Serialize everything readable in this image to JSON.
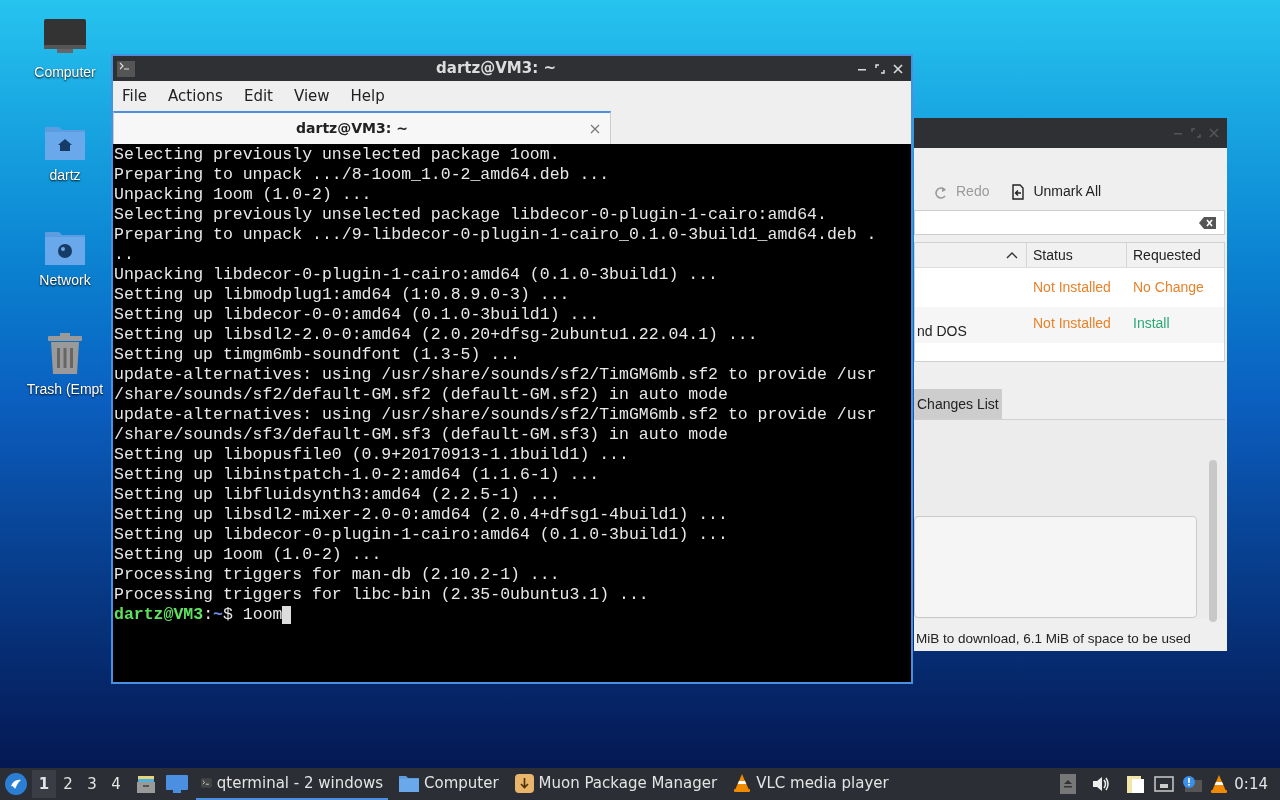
{
  "desktop_icons": [
    {
      "kind": "monitor",
      "label": "Computer"
    },
    {
      "kind": "home",
      "label": "dartz"
    },
    {
      "kind": "network",
      "label": "Network"
    },
    {
      "kind": "trash",
      "label": "Trash (Empt"
    }
  ],
  "muon": {
    "toolbar": [
      {
        "label": "Redo",
        "disabled": true,
        "kind": "redo"
      },
      {
        "label": "Unmark All",
        "disabled": false,
        "kind": "unmark"
      }
    ],
    "columns": [
      "Status",
      "Requested"
    ],
    "rows": [
      {
        "name": "",
        "status": {
          "text": "Not Installed",
          "color": "#e8822a"
        },
        "requested": {
          "text": "No Change",
          "color": "#e8822a"
        }
      },
      {
        "name": "nd DOS",
        "status": {
          "text": "Not Installed",
          "color": "#e8822a"
        },
        "requested": {
          "text": "Install",
          "color": "#2aa876"
        }
      }
    ],
    "tabs": [
      {
        "label": "Changes List",
        "selected": true
      }
    ],
    "status_bar": "MiB to download, 6.1 MiB of space to be used"
  },
  "terminal": {
    "title": "dartz@VM3: ~",
    "menu": [
      "File",
      "Actions",
      "Edit",
      "View",
      "Help"
    ],
    "tabs": [
      {
        "label": "dartz@VM3: ~",
        "selected": true
      }
    ],
    "lines": [
      {
        "kind": "output",
        "text": "Selecting previously unselected package 1oom."
      },
      {
        "kind": "output",
        "text": "Preparing to unpack .../8-1oom_1.0-2_amd64.deb ..."
      },
      {
        "kind": "output",
        "text": "Unpacking 1oom (1.0-2) ..."
      },
      {
        "kind": "output",
        "text": "Selecting previously unselected package libdecor-0-plugin-1-cairo:amd64."
      },
      {
        "kind": "output",
        "text": "Preparing to unpack .../9-libdecor-0-plugin-1-cairo_0.1.0-3build1_amd64.deb ."
      },
      {
        "kind": "output",
        "text": ".."
      },
      {
        "kind": "output",
        "text": "Unpacking libdecor-0-plugin-1-cairo:amd64 (0.1.0-3build1) ..."
      },
      {
        "kind": "output",
        "text": "Setting up libmodplug1:amd64 (1:0.8.9.0-3) ..."
      },
      {
        "kind": "output",
        "text": "Setting up libdecor-0-0:amd64 (0.1.0-3build1) ..."
      },
      {
        "kind": "output",
        "text": "Setting up libsdl2-2.0-0:amd64 (2.0.20+dfsg-2ubuntu1.22.04.1) ..."
      },
      {
        "kind": "output",
        "text": "Setting up timgm6mb-soundfont (1.3-5) ..."
      },
      {
        "kind": "output",
        "text": "update-alternatives: using /usr/share/sounds/sf2/TimGM6mb.sf2 to provide /usr"
      },
      {
        "kind": "output",
        "text": "/share/sounds/sf2/default-GM.sf2 (default-GM.sf2) in auto mode"
      },
      {
        "kind": "output",
        "text": "update-alternatives: using /usr/share/sounds/sf2/TimGM6mb.sf2 to provide /usr"
      },
      {
        "kind": "output",
        "text": "/share/sounds/sf3/default-GM.sf3 (default-GM.sf3) in auto mode"
      },
      {
        "kind": "output",
        "text": "Setting up libopusfile0 (0.9+20170913-1.1build1) ..."
      },
      {
        "kind": "output",
        "text": "Setting up libinstpatch-1.0-2:amd64 (1.1.6-1) ..."
      },
      {
        "kind": "output",
        "text": "Setting up libfluidsynth3:amd64 (2.2.5-1) ..."
      },
      {
        "kind": "output",
        "text": "Setting up libsdl2-mixer-2.0-0:amd64 (2.0.4+dfsg1-4build1) ..."
      },
      {
        "kind": "output",
        "text": "Setting up libdecor-0-plugin-1-cairo:amd64 (0.1.0-3build1) ..."
      },
      {
        "kind": "output",
        "text": "Setting up 1oom (1.0-2) ..."
      },
      {
        "kind": "output",
        "text": "Processing triggers for man-db (2.10.2-1) ..."
      },
      {
        "kind": "output",
        "text": "Processing triggers for libc-bin (2.35-0ubuntu3.1) ..."
      },
      {
        "kind": "prompt",
        "host": "dartz@VM3",
        "sep": ":",
        "path": "~",
        "sign": "$",
        "command": "1oom"
      }
    ]
  },
  "taskbar": {
    "workspaces": [
      {
        "label": "1",
        "selected": true
      },
      {
        "label": "2",
        "selected": false
      },
      {
        "label": "3",
        "selected": false
      },
      {
        "label": "4",
        "selected": false
      }
    ],
    "tasks": [
      {
        "kind": "terminal",
        "label": "qterminal - 2 windows",
        "selected": true
      },
      {
        "kind": "folder",
        "label": "Computer",
        "selected": false
      },
      {
        "kind": "package",
        "label": "Muon Package Manager",
        "selected": false
      },
      {
        "kind": "vlc",
        "label": "VLC media player",
        "selected": false
      }
    ],
    "clock": "0:14"
  }
}
